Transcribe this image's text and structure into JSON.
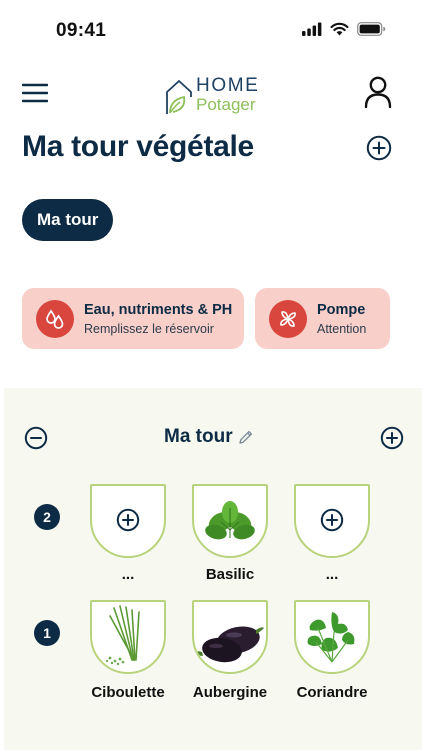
{
  "status": {
    "time": "09:41"
  },
  "header": {
    "logo_line1": "HOME",
    "logo_line2": "Potager"
  },
  "page": {
    "title": "Ma tour végétale"
  },
  "chips": [
    {
      "label": "Ma tour"
    }
  ],
  "alerts": [
    {
      "title": "Eau, nutriments & PH",
      "subtitle": "Remplissez le réservoir",
      "icon": "water-drops-icon"
    },
    {
      "title": "Pompe",
      "subtitle": "Attention",
      "icon": "pump-fan-icon"
    }
  ],
  "tower": {
    "title": "Ma tour",
    "rows": [
      {
        "number": "2",
        "slots": [
          {
            "label": "...",
            "plant": null
          },
          {
            "label": "Basilic",
            "plant": "basil"
          },
          {
            "label": "...",
            "plant": null
          }
        ]
      },
      {
        "number": "1",
        "slots": [
          {
            "label": "Ciboulette",
            "plant": "chives"
          },
          {
            "label": "Aubergine",
            "plant": "eggplant"
          },
          {
            "label": "Coriandre",
            "plant": "coriander"
          }
        ]
      }
    ]
  },
  "colors": {
    "navy": "#0d2b45",
    "alert_bg": "#f8cfc9",
    "alert_icon": "#d8463d",
    "leaf_green": "#8dbf5a",
    "panel_bg": "#f7f8f0"
  }
}
